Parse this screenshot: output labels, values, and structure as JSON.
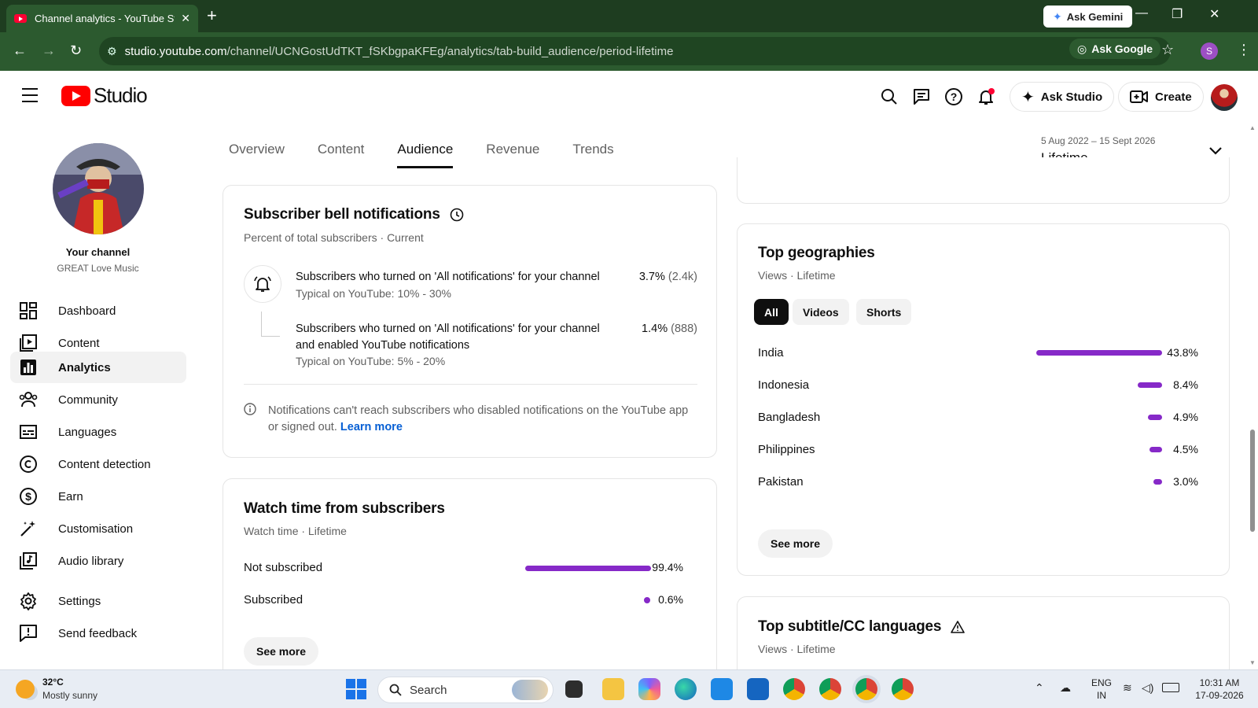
{
  "browser": {
    "tab_title": "Channel analytics - YouTube Studio",
    "ask_gemini": "Ask Gemini",
    "url_host": "studio.youtube.com",
    "url_path": "/channel/UCNGostUdTKT_fSKbgpaKFEg/analytics/tab-build_audience/period-lifetime",
    "ask_google": "Ask Google",
    "profile_initial": "S"
  },
  "header": {
    "brand": "Studio",
    "ask_studio": "Ask Studio",
    "create": "Create"
  },
  "sidebar": {
    "channel_title": "Your channel",
    "channel_name": "GREAT Love Music",
    "items": [
      {
        "label": "Dashboard",
        "icon": "dashboard-icon"
      },
      {
        "label": "Content",
        "icon": "content-icon"
      },
      {
        "label": "Analytics",
        "icon": "analytics-icon",
        "active": true
      },
      {
        "label": "Community",
        "icon": "community-icon"
      },
      {
        "label": "Languages",
        "icon": "languages-icon"
      },
      {
        "label": "Content detection",
        "icon": "copyright-icon"
      },
      {
        "label": "Earn",
        "icon": "dollar-icon"
      },
      {
        "label": "Customisation",
        "icon": "magic-wand-icon"
      },
      {
        "label": "Audio library",
        "icon": "audio-library-icon"
      }
    ],
    "settings": "Settings",
    "feedback": "Send feedback"
  },
  "tabs": [
    "Overview",
    "Content",
    "Audience",
    "Revenue",
    "Trends"
  ],
  "active_tab": "Audience",
  "period": {
    "range": "5 Aug 2022 – 15 Sept 2026",
    "label": "Lifetime"
  },
  "bell_card": {
    "title": "Subscriber bell notifications",
    "subtitle": "Percent of total subscribers · Current",
    "row1": {
      "text": "Subscribers who turned on 'All notifications' for your channel",
      "typical": "Typical on YouTube: 10% - 30%",
      "value": "3.7%",
      "count": "(2.4k)"
    },
    "row2": {
      "text_line1": "Subscribers who turned on 'All notifications' for your channel",
      "text_line2": "and enabled YouTube notifications",
      "typical": "Typical on YouTube: 5% - 20%",
      "value": "1.4%",
      "count": "(888)"
    },
    "note_line1": "Notifications can't reach subscribers who disabled notifications on the YouTube app",
    "note_line2": "or signed out.",
    "learn_more": "Learn more"
  },
  "watch_card": {
    "title": "Watch time from subscribers",
    "subtitle": "Watch time · Lifetime",
    "rows": [
      {
        "label": "Not subscribed",
        "pct": "99.4%",
        "value": 99.4
      },
      {
        "label": "Subscribed",
        "pct": "0.6%",
        "value": 0.6
      }
    ],
    "see_more": "See more"
  },
  "geo_card": {
    "title": "Top geographies",
    "subtitle": "Views · Lifetime",
    "chips": [
      "All",
      "Videos",
      "Shorts"
    ],
    "rows": [
      {
        "label": "India",
        "pct": "43.8%",
        "value": 43.8
      },
      {
        "label": "Indonesia",
        "pct": "8.4%",
        "value": 8.4
      },
      {
        "label": "Bangladesh",
        "pct": "4.9%",
        "value": 4.9
      },
      {
        "label": "Philippines",
        "pct": "4.5%",
        "value": 4.5
      },
      {
        "label": "Pakistan",
        "pct": "3.0%",
        "value": 3.0
      }
    ],
    "see_more": "See more"
  },
  "cc_card": {
    "title": "Top subtitle/CC languages",
    "subtitle": "Views · Lifetime"
  },
  "taskbar": {
    "temp": "32°C",
    "weather": "Mostly sunny",
    "search": "Search",
    "lang1": "ENG",
    "lang2": "IN",
    "time": "10:31 AM",
    "date": "17-09-2026"
  },
  "colors": {
    "accent_bar": "#8629c8",
    "browser_chrome": "#2c5a2f",
    "link": "#065fd4"
  }
}
